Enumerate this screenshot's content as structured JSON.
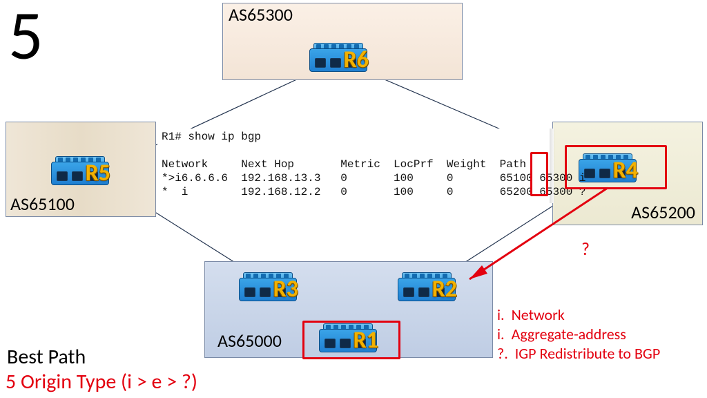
{
  "slide_number": "5",
  "as_boxes": {
    "top": {
      "label": "AS65300"
    },
    "left": {
      "label": "AS65100"
    },
    "right": {
      "label": "AS65200"
    },
    "bottom": {
      "label": "AS65000"
    }
  },
  "routers": {
    "r6": "R6",
    "r5": "R5",
    "r4": "R4",
    "r3": "R3",
    "r2": "R2",
    "r1": "R1"
  },
  "terminal": {
    "prompt": "R1# show ip bgp",
    "headers": "Network     Next Hop       Metric  LocPrf  Weight  Path",
    "row1": "*>i6.6.6.6  192.168.13.3   0       100     0       65100 65300 i",
    "row2": "*  i        192.168.12.2   0       100     0       65200 65300 ?"
  },
  "origin_col": {
    "r1": "i",
    "r2": "?"
  },
  "question_mark": "?",
  "legend": {
    "l1": {
      "code": "i.",
      "text": "Network"
    },
    "l2": {
      "code": "i.",
      "text": "Aggregate-address"
    },
    "l3": {
      "code": "?.",
      "text": "IGP Redistribute to BGP"
    }
  },
  "footer": {
    "black": "Best Path",
    "red": "5 Origin Type (i > e > ?)"
  }
}
